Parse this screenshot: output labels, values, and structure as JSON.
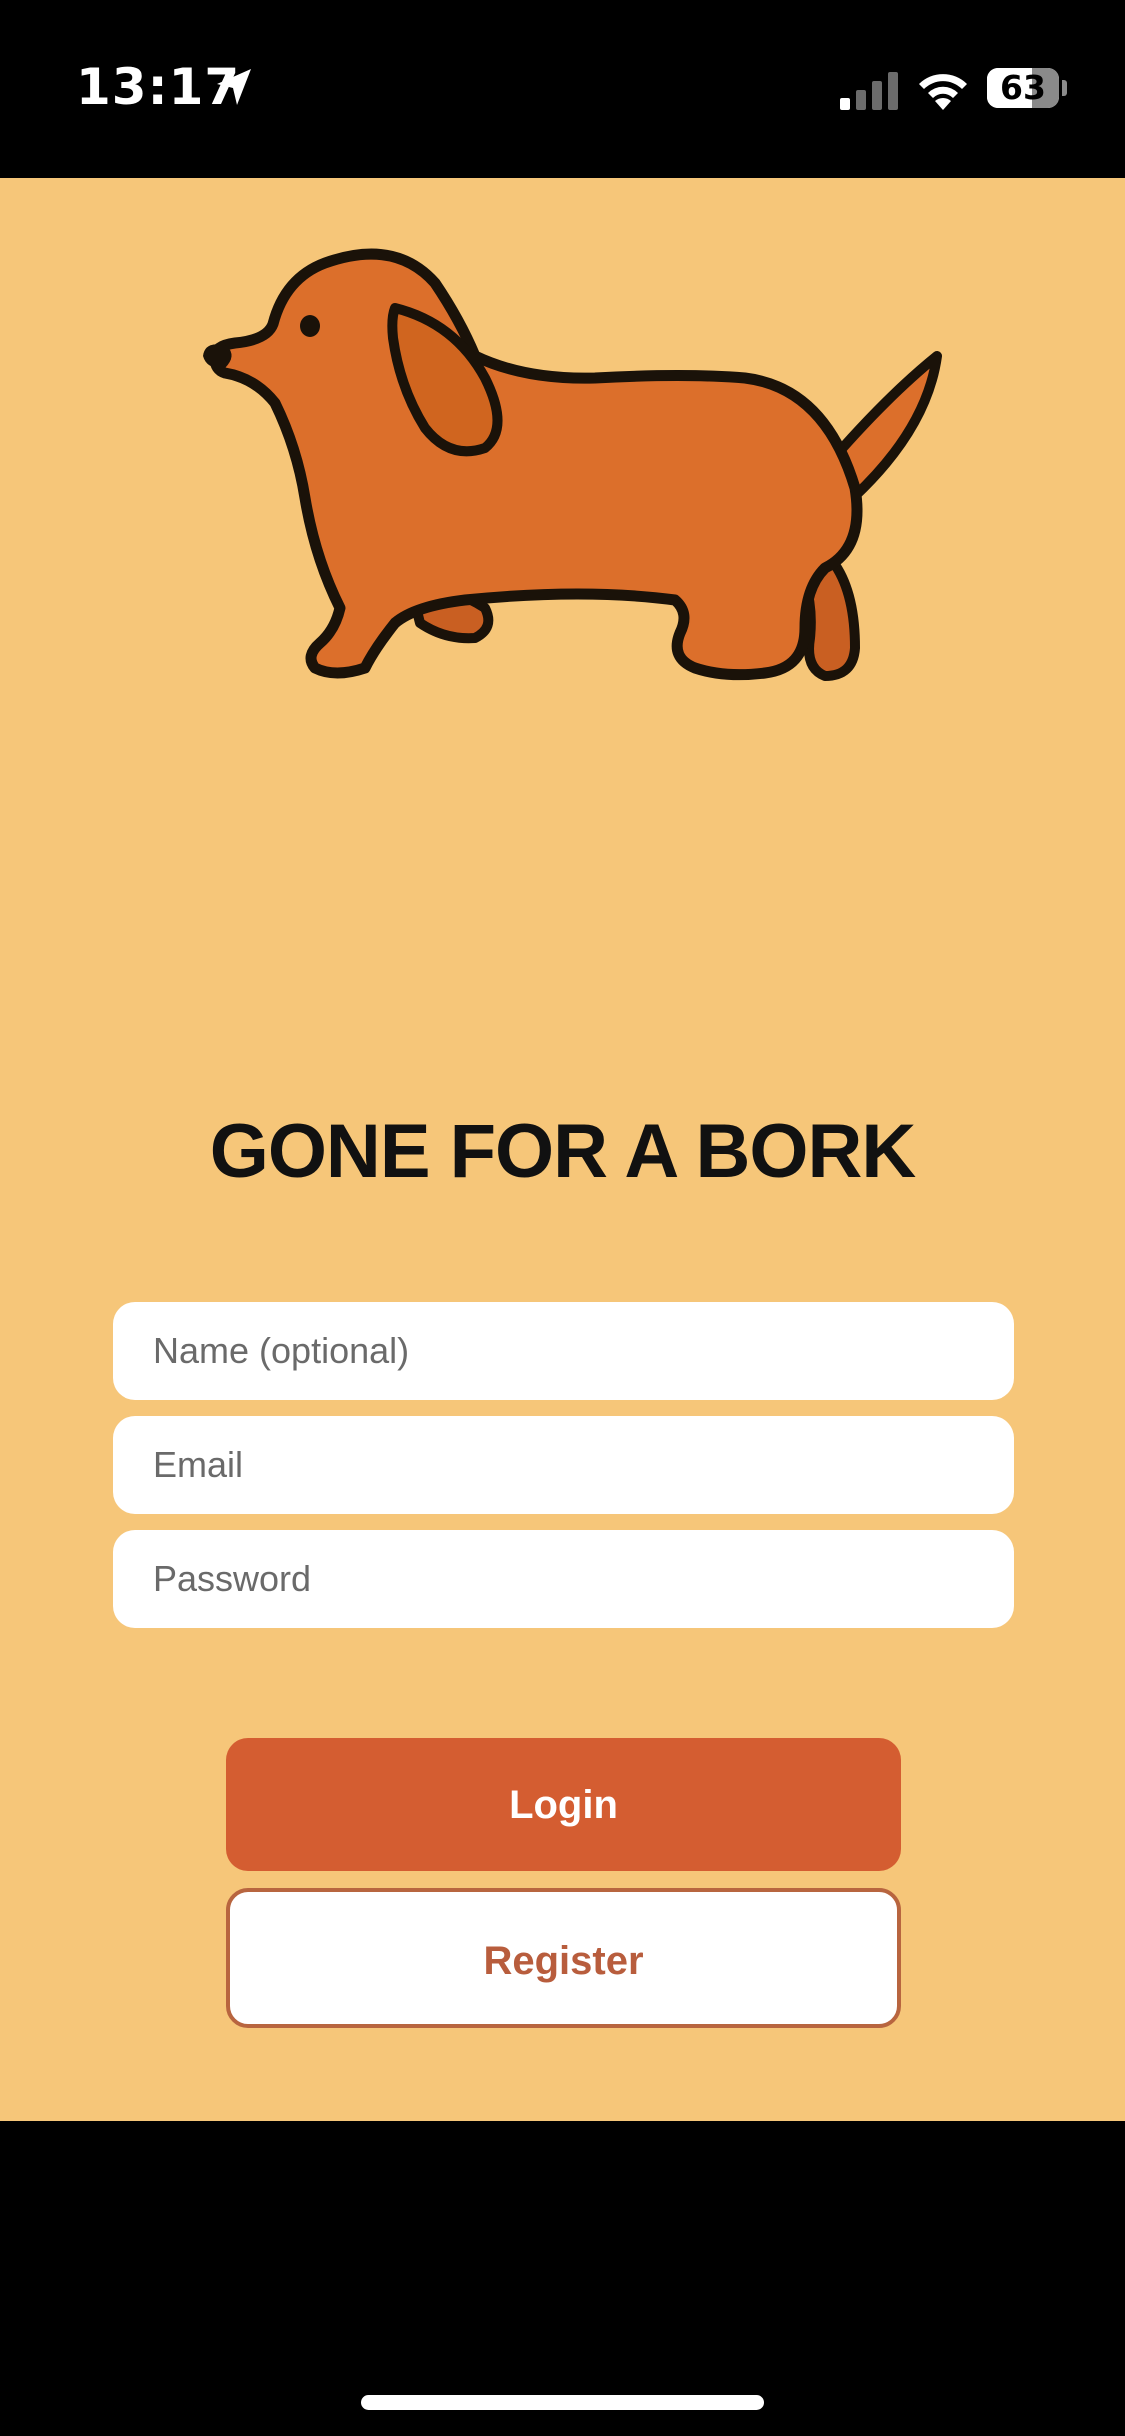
{
  "status_bar": {
    "time": "13:17",
    "battery_text": "63",
    "battery_level": 0.63,
    "icons": [
      "location-arrow-icon",
      "cellular-signal-icon",
      "wifi-icon",
      "battery-icon"
    ]
  },
  "app": {
    "illustration": "dachshund-illustration",
    "title": "GONE FOR A BORK",
    "fields": {
      "name_placeholder": "Name (optional)",
      "email_placeholder": "Email",
      "password_placeholder": "Password"
    },
    "buttons": {
      "login_label": "Login",
      "register_label": "Register"
    }
  },
  "colors": {
    "background": "#f6c679",
    "primary_button": "#d45d31",
    "secondary_text": "#b85d3d",
    "dog_body": "#dc6f2b",
    "outline": "#1a1209"
  }
}
